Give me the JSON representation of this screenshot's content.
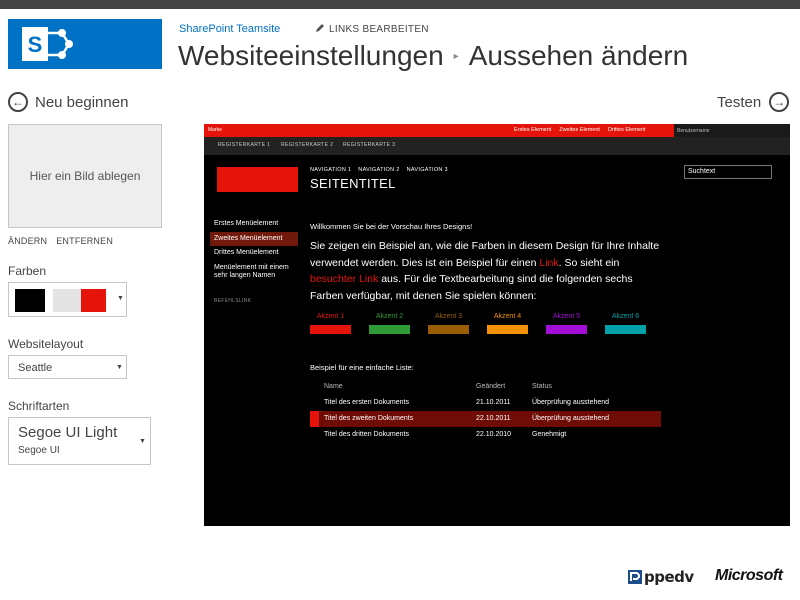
{
  "header": {
    "site_name": "SharePoint Teamsite",
    "edit_links": "LINKS BEARBEITEN",
    "title_part1": "Websiteeinstellungen",
    "title_part2": "Aussehen ändern",
    "brand_color": "#0072c6"
  },
  "actions": {
    "restart": "Neu beginnen",
    "test": "Testen"
  },
  "image": {
    "dropzone": "Hier ein Bild ablegen",
    "change": "ÄNDERN",
    "remove": "ENTFERNEN"
  },
  "colors": {
    "label": "Farben",
    "swatches": [
      "#000000",
      "#e4e4e4",
      "#e5140a"
    ]
  },
  "layout": {
    "label": "Websitelayout",
    "value": "Seattle"
  },
  "fonts": {
    "label": "Schriftarten",
    "heading": "Segoe UI Light",
    "body": "Segoe UI"
  },
  "preview": {
    "brand": "Marke",
    "top_nav": [
      "Erstes Element",
      "Zweites Element",
      "Drittes Element"
    ],
    "user": "Benutzername",
    "tabs": [
      "REGISTERKARTE 1",
      "REGISTERKARTE 2",
      "REGISTERKARTE 3"
    ],
    "nav": [
      "NAVIGATION 1",
      "NAVIGATION 2",
      "NAVIGATION 3"
    ],
    "page_title": "SEITENTITEL",
    "search": "Suchtext",
    "menu": {
      "item1": "Erstes Menüelement",
      "item2": "Zweites Menüelement",
      "item3": "Drittes Menüelement",
      "item4": "Menüelement mit einem sehr langen Namen",
      "command": "BEFEHLSLINK"
    },
    "welcome": "Willkommen Sie bei der Vorschau Ihres Designs!",
    "para_a": "Sie zeigen ein Beispiel an, wie die Farben in diesem Design für Ihre Inhalte verwendet werden. Dies ist ein Beispiel für einen ",
    "link": "Link",
    "para_b": ". So sieht ein ",
    "visited_link": "besuchter Link",
    "para_c": " aus. Für die Textbearbeitung sind die folgenden sechs Farben verfügbar, mit denen Sie spielen können:",
    "accents": [
      {
        "label": "Akzent 1",
        "color": "#e5140a"
      },
      {
        "label": "Akzent 2",
        "color": "#2f9b35"
      },
      {
        "label": "Akzent 3",
        "color": "#9a5d03"
      },
      {
        "label": "Akzent 4",
        "color": "#f39208"
      },
      {
        "label": "Akzent 5",
        "color": "#a20ed8"
      },
      {
        "label": "Akzent 6",
        "color": "#00a2a8"
      }
    ],
    "list_title": "Beispiel für eine einfache Liste:",
    "table": {
      "headers": {
        "name": "Name",
        "changed": "Geändert",
        "status": "Status"
      },
      "rows": [
        {
          "name": "Titel des ersten Dokuments",
          "changed": "21.10.2011",
          "status": "Überprüfung ausstehend"
        },
        {
          "name": "Titel des zweiten Dokuments",
          "changed": "22.10.2011",
          "status": "Überprüfung ausstehend"
        },
        {
          "name": "Titel des dritten Dokuments",
          "changed": "22.10.2010",
          "status": "Genehmigt"
        }
      ]
    }
  },
  "footer": {
    "ppedv": "ppedv",
    "microsoft": "Microsoft"
  }
}
